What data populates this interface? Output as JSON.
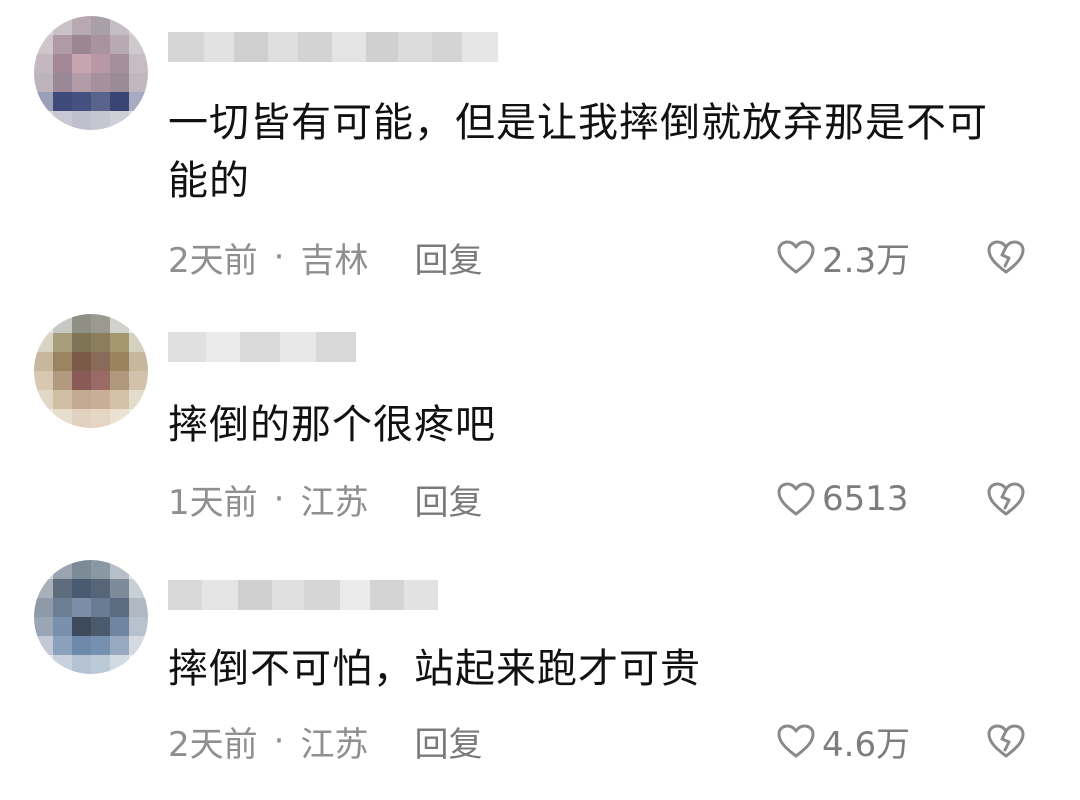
{
  "comments": [
    {
      "text": "一切皆有可能，但是让我摔倒就放弃那是不可能的",
      "time": "2天前",
      "location": "吉林",
      "reply_label": "回复",
      "likes": "2.3万"
    },
    {
      "text": "摔倒的那个很疼吧",
      "time": "1天前",
      "location": "江苏",
      "reply_label": "回复",
      "likes": "6513"
    },
    {
      "text": "摔倒不可怕，站起来跑才可贵",
      "time": "2天前",
      "location": "江苏",
      "reply_label": "回复",
      "likes": "4.6万"
    }
  ],
  "colors": {
    "text": "#111111",
    "meta": "#8f8f8f",
    "icon": "#8a8a8a"
  },
  "icons": {
    "like": "heart-icon",
    "dislike": "broken-heart-icon"
  }
}
